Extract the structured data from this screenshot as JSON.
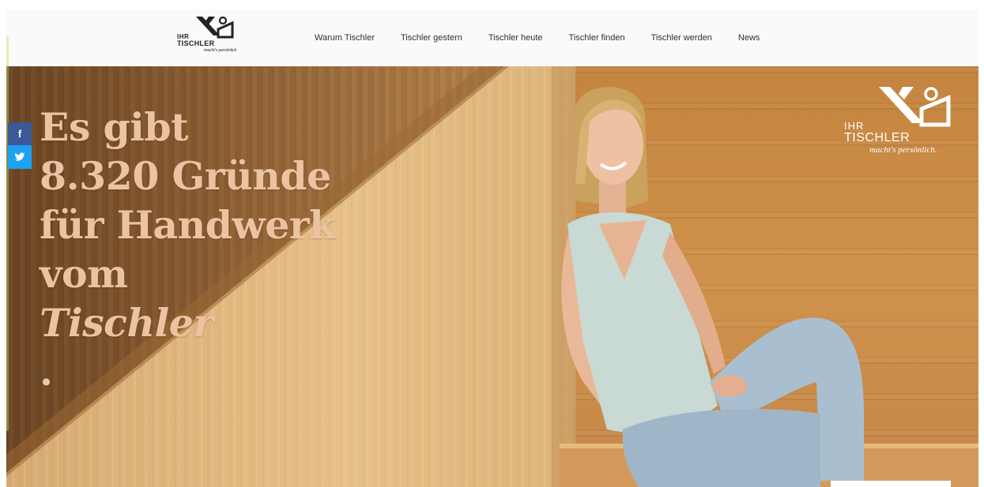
{
  "brand": {
    "logo_line1": "IHR",
    "logo_line2": "TISCHLER",
    "logo_tagline": "macht's persönlich."
  },
  "nav": {
    "items": [
      {
        "label": "Warum Tischler"
      },
      {
        "label": "Tischler gestern"
      },
      {
        "label": "Tischler heute"
      },
      {
        "label": "Tischler finden"
      },
      {
        "label": "Tischler werden"
      },
      {
        "label": "News"
      }
    ]
  },
  "hero": {
    "headline_line1": "Es gibt",
    "headline_line2": "8.320 Gründe",
    "headline_line3": "für Handwerk",
    "headline_line4_prefix": "vom ",
    "headline_line4_italic": "Tischler",
    "headline_line4_suffix": ".",
    "logo_line1": "IHR",
    "logo_line2": "TISCHLER",
    "logo_tagline": "macht's persönlich."
  },
  "social": {
    "facebook_glyph": "f",
    "twitter_icon": "twitter-bird-icon"
  },
  "colors": {
    "headline": "#ebc3a2",
    "facebook": "#3b5998",
    "twitter": "#1da1f2",
    "wood": "#c98f4c"
  }
}
